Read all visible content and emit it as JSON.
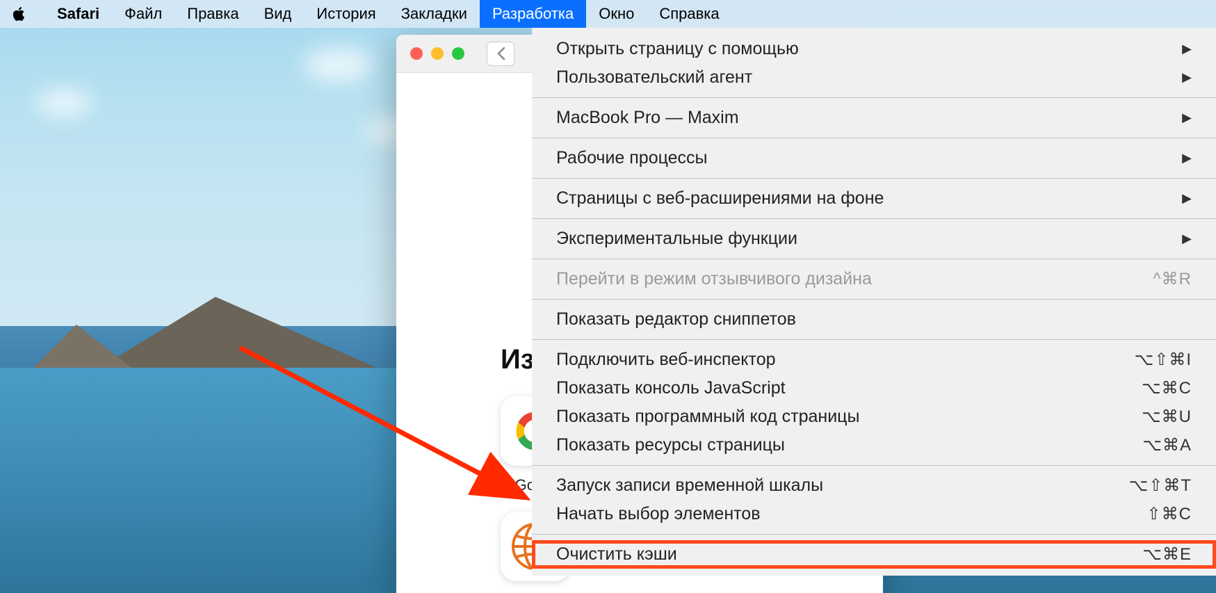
{
  "menubar": {
    "app_name": "Safari",
    "items": [
      "Файл",
      "Правка",
      "Вид",
      "История",
      "Закладки",
      "Разработка",
      "Окно",
      "Справка"
    ],
    "active_index": 5
  },
  "safari_window": {
    "favorites_title": "Избр",
    "favorites": [
      {
        "label": "Googl",
        "icon": "google"
      }
    ]
  },
  "dropdown": {
    "sections": [
      [
        {
          "label": "Открыть страницу с помощью",
          "submenu": true
        },
        {
          "label": "Пользовательский агент",
          "submenu": true
        }
      ],
      [
        {
          "label": "MacBook Pro — Maxim",
          "submenu": true
        }
      ],
      [
        {
          "label": "Рабочие процессы",
          "submenu": true
        }
      ],
      [
        {
          "label": "Страницы с веб-расширениями на фоне",
          "submenu": true
        }
      ],
      [
        {
          "label": "Экспериментальные функции",
          "submenu": true
        }
      ],
      [
        {
          "label": "Перейти в режим отзывчивого дизайна",
          "shortcut": "^⌘R",
          "disabled": true
        }
      ],
      [
        {
          "label": "Показать редактор сниппетов"
        }
      ],
      [
        {
          "label": "Подключить веб-инспектор",
          "shortcut": "⌥⇧⌘I"
        },
        {
          "label": "Показать консоль JavaScript",
          "shortcut": "⌥⌘C"
        },
        {
          "label": "Показать программный код страницы",
          "shortcut": "⌥⌘U"
        },
        {
          "label": "Показать ресурсы страницы",
          "shortcut": "⌥⌘A"
        }
      ],
      [
        {
          "label": "Запуск записи временной шкалы",
          "shortcut": "⌥⇧⌘T"
        },
        {
          "label": "Начать выбор элементов",
          "shortcut": "⇧⌘C"
        }
      ],
      [
        {
          "label": "Очистить кэши",
          "shortcut": "⌥⌘E",
          "highlighted": true
        }
      ]
    ]
  }
}
